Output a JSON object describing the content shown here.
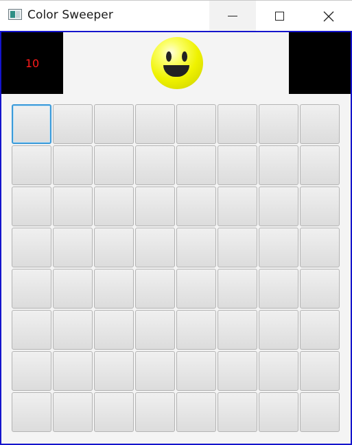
{
  "window": {
    "title": "Color Sweeper",
    "controls": [
      "minimize-button",
      "maximize-button",
      "close-button"
    ]
  },
  "header": {
    "left_counter": "10",
    "right_counter": "",
    "face": "smiley-icon"
  },
  "board": {
    "rows": 8,
    "cols": 8,
    "focused_cell": [
      0,
      0
    ],
    "colors": {
      "frame_border": "#1414cc",
      "counter_bg": "#000000",
      "counter_text": "#ff1a1a",
      "face": "#eff200",
      "focus": "#3a9ad9"
    }
  }
}
